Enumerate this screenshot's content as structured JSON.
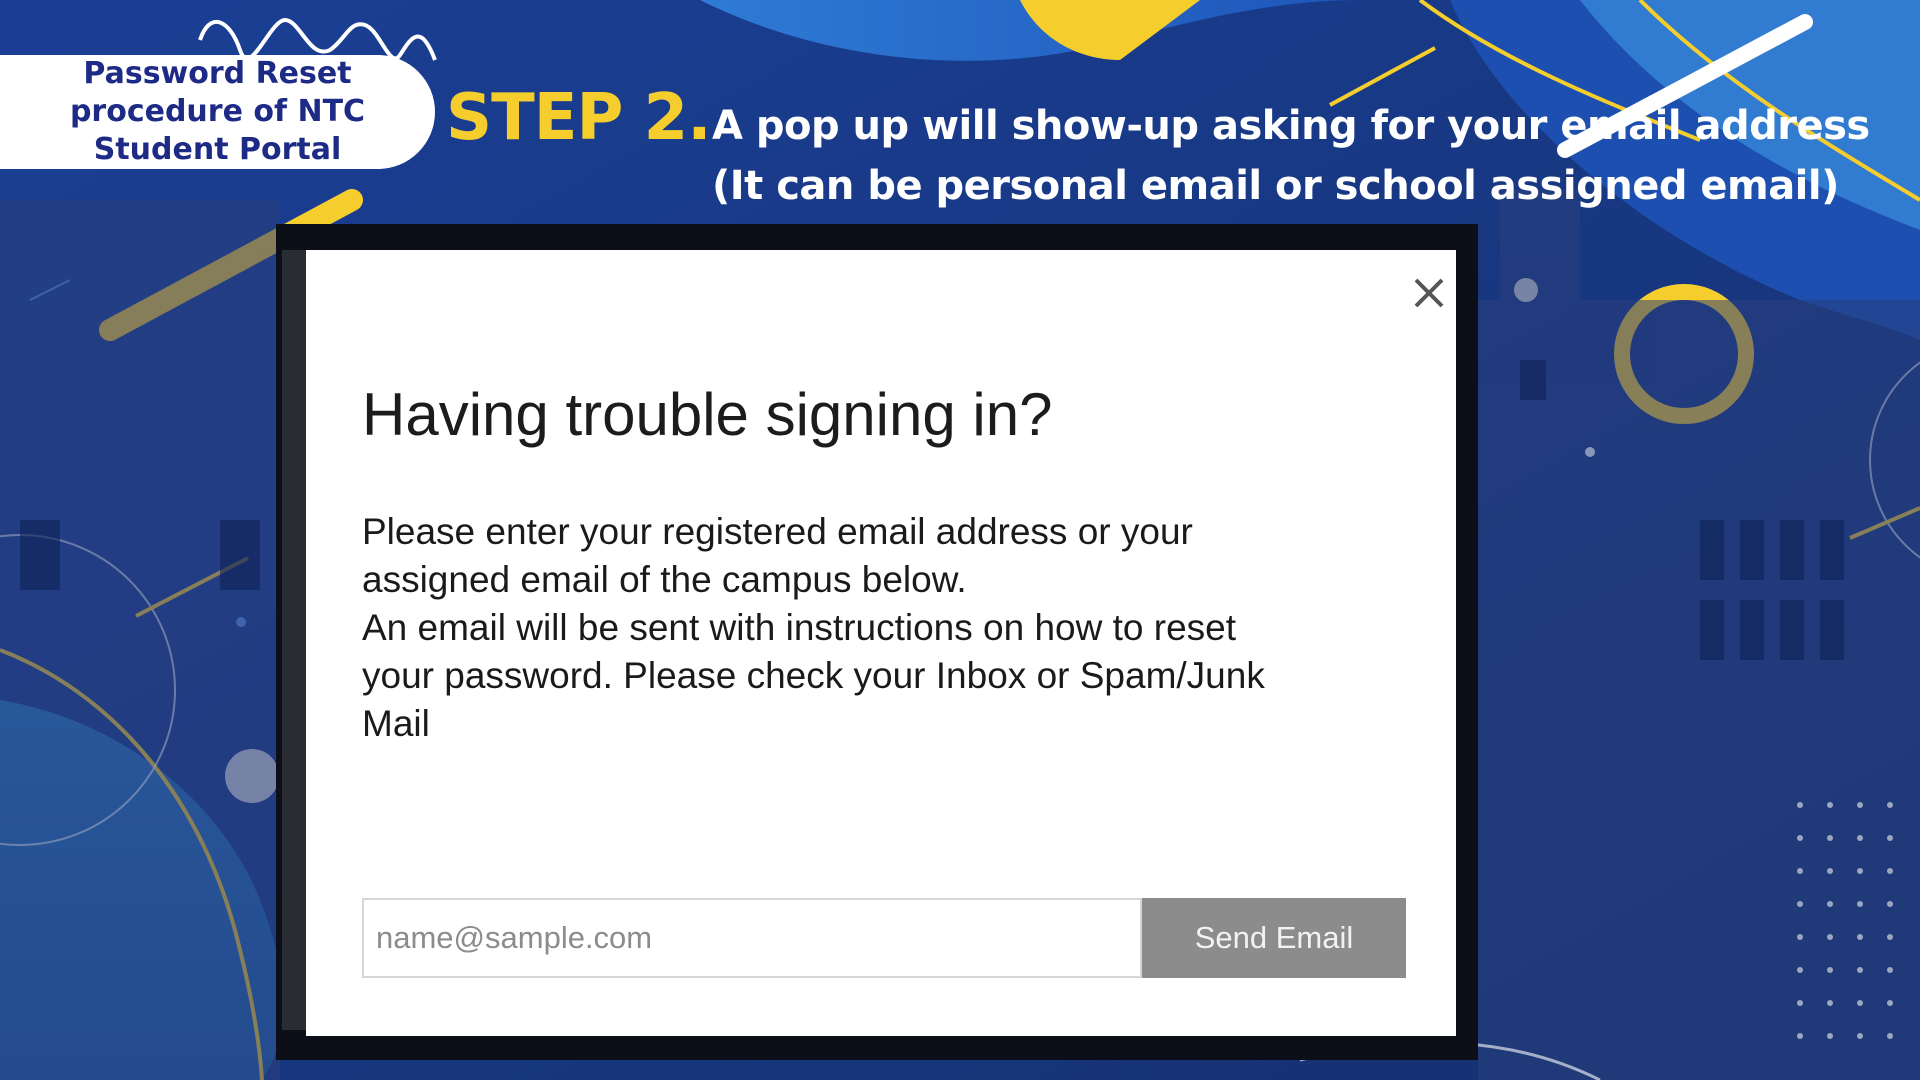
{
  "slide": {
    "title_lines": [
      "Password Reset",
      "procedure of NTC",
      "Student Portal"
    ],
    "step_label": "STEP 2.",
    "instruction_lines": [
      "A pop up will show-up asking for your email address",
      "(It can be personal email or school assigned email)"
    ]
  },
  "modal": {
    "heading": "Having trouble signing in?",
    "body_lines": [
      "Please enter your registered email address or your",
      "assigned email of the campus below.",
      "An email will be sent with instructions on how to reset",
      "your password. Please check your Inbox or Spam/Junk",
      "Mail"
    ],
    "email_placeholder": "name@sample.com",
    "send_button_label": "Send Email",
    "close_icon": "close-icon"
  },
  "colors": {
    "accent_yellow": "#f5cd2c",
    "title_blue": "#1d2b86",
    "background_blue": "#173a8a",
    "button_gray": "#8c8c8c"
  }
}
